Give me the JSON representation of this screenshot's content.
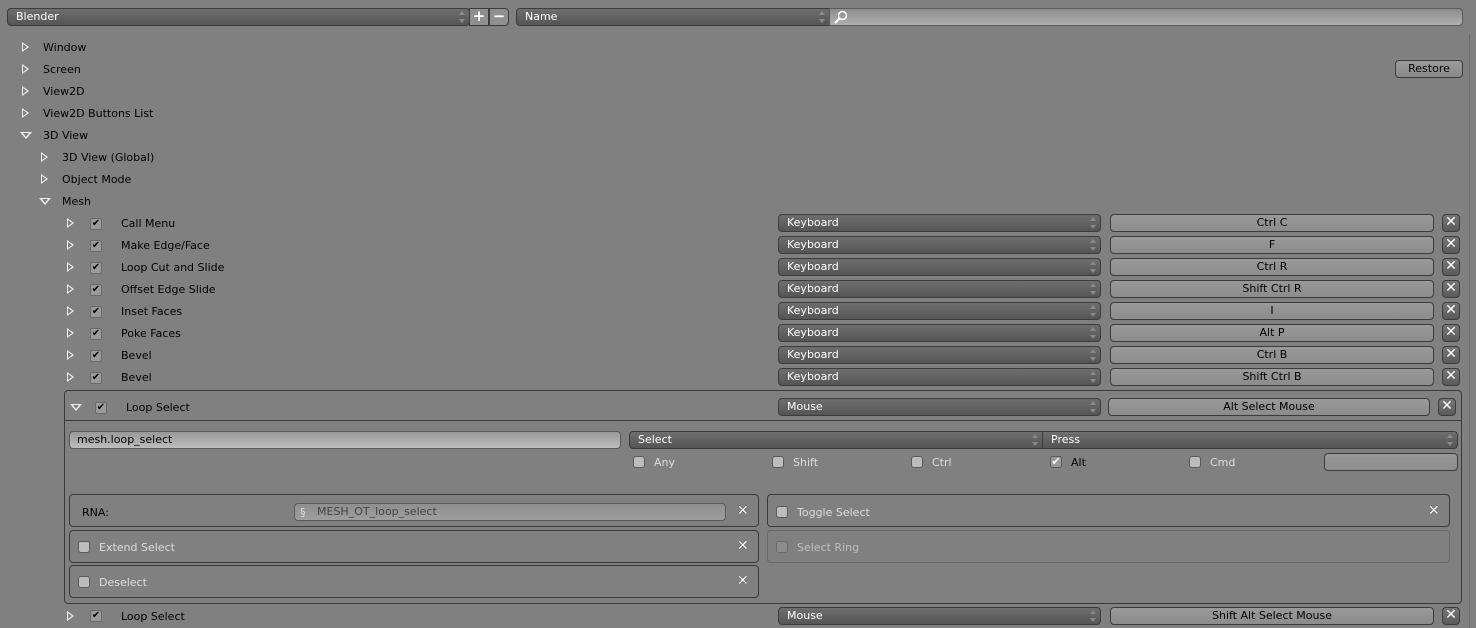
{
  "header": {
    "preset": "Blender",
    "add_label": "+",
    "remove_label": "−",
    "filter_type": "Name",
    "search_placeholder": "",
    "search_icon": "magnifier-icon"
  },
  "restore_label": "Restore",
  "tree": {
    "top": [
      "Window",
      "Screen",
      "View2D",
      "View2D Buttons List",
      "3D View"
    ],
    "view3d_children": [
      "3D View (Global)",
      "Object Mode",
      "Mesh"
    ]
  },
  "mesh_items": [
    {
      "name": "Call Menu",
      "type": "Keyboard",
      "key": "Ctrl C",
      "enabled": true
    },
    {
      "name": "Make Edge/Face",
      "type": "Keyboard",
      "key": "F",
      "enabled": true
    },
    {
      "name": "Loop Cut and Slide",
      "type": "Keyboard",
      "key": "Ctrl R",
      "enabled": true
    },
    {
      "name": "Offset Edge Slide",
      "type": "Keyboard",
      "key": "Shift Ctrl R",
      "enabled": true
    },
    {
      "name": "Inset Faces",
      "type": "Keyboard",
      "key": "I",
      "enabled": true
    },
    {
      "name": "Poke Faces",
      "type": "Keyboard",
      "key": "Alt P",
      "enabled": true
    },
    {
      "name": "Bevel",
      "type": "Keyboard",
      "key": "Ctrl B",
      "enabled": true
    },
    {
      "name": "Bevel",
      "type": "Keyboard",
      "key": "Shift Ctrl B",
      "enabled": true
    }
  ],
  "expanded_item": {
    "name": "Loop Select",
    "type": "Mouse",
    "key": "Alt Select Mouse",
    "enabled": true,
    "operator": "mesh.loop_select",
    "event": "Select",
    "value": "Press",
    "modifiers": [
      {
        "label": "Any",
        "checked": false
      },
      {
        "label": "Shift",
        "checked": false
      },
      {
        "label": "Ctrl",
        "checked": false
      },
      {
        "label": "Alt",
        "checked": true
      },
      {
        "label": "Cmd",
        "checked": false
      }
    ],
    "key_modifier_value": "",
    "rna_label": "RNA:",
    "rna_value": "MESH_OT_loop_select",
    "properties": {
      "extend_select": {
        "label": "Extend Select",
        "checked": false
      },
      "deselect": {
        "label": "Deselect",
        "checked": false
      },
      "toggle_select": {
        "label": "Toggle Select",
        "checked": false
      },
      "select_ring": {
        "label": "Select Ring",
        "checked": false
      }
    }
  },
  "last_item": {
    "name": "Loop Select",
    "type": "Mouse",
    "key": "Shift Alt Select Mouse",
    "enabled": true
  }
}
